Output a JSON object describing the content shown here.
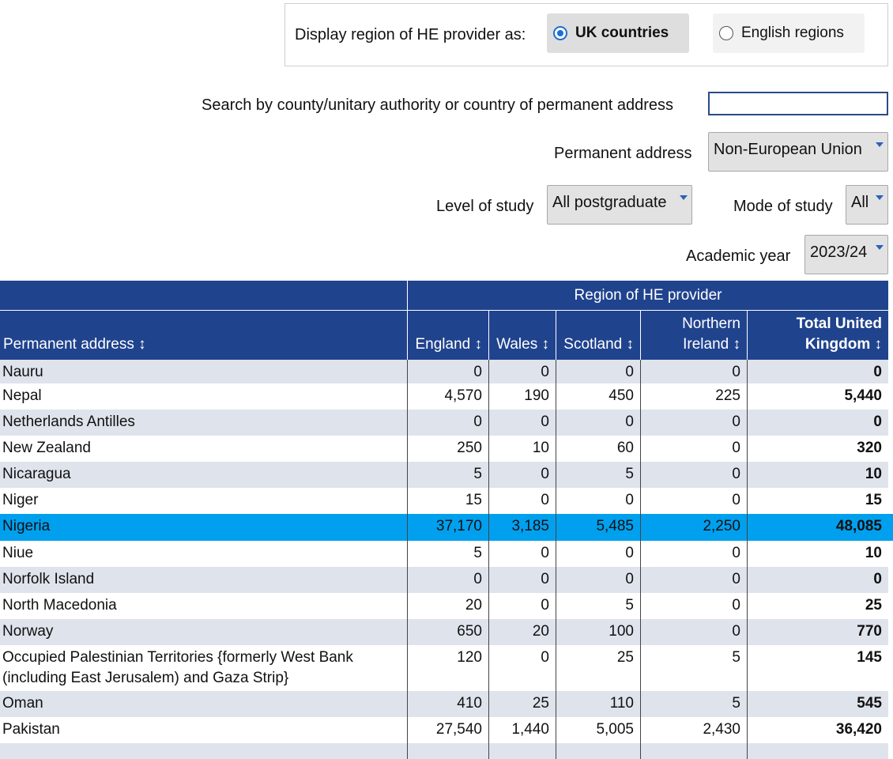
{
  "region_toggle": {
    "label": "Display region of HE provider as:",
    "options": [
      {
        "label": "UK countries",
        "selected": true
      },
      {
        "label": "English regions",
        "selected": false
      }
    ]
  },
  "filters": {
    "search_label": "Search by county/unitary authority or country of permanent address",
    "search_value": "",
    "permanent_address_label": "Permanent address",
    "permanent_address_value": "Non-European Union",
    "level_label": "Level of study",
    "level_value": "All postgraduate",
    "mode_label": "Mode of study",
    "mode_value": "All",
    "year_label": "Academic year",
    "year_value": "2023/24"
  },
  "table": {
    "group_header": "Region of HE provider",
    "columns": [
      {
        "label": "Permanent address ↕"
      },
      {
        "label": "England ↕"
      },
      {
        "label": "Wales ↕"
      },
      {
        "label": "Scotland ↕"
      },
      {
        "label": "Northern Ireland ↕"
      },
      {
        "label": "Total United Kingdom ↕"
      }
    ],
    "rows": [
      {
        "name": "Nauru",
        "england": "0",
        "wales": "0",
        "scotland": "0",
        "ni": "0",
        "total": "0"
      },
      {
        "name": "Nepal",
        "england": "4,570",
        "wales": "190",
        "scotland": "450",
        "ni": "225",
        "total": "5,440"
      },
      {
        "name": "Netherlands Antilles",
        "england": "0",
        "wales": "0",
        "scotland": "0",
        "ni": "0",
        "total": "0"
      },
      {
        "name": "New Zealand",
        "england": "250",
        "wales": "10",
        "scotland": "60",
        "ni": "0",
        "total": "320"
      },
      {
        "name": "Nicaragua",
        "england": "5",
        "wales": "0",
        "scotland": "5",
        "ni": "0",
        "total": "10"
      },
      {
        "name": "Niger",
        "england": "15",
        "wales": "0",
        "scotland": "0",
        "ni": "0",
        "total": "15"
      },
      {
        "name": "Nigeria",
        "england": "37,170",
        "wales": "3,185",
        "scotland": "5,485",
        "ni": "2,250",
        "total": "48,085",
        "highlighted": true
      },
      {
        "name": "Niue",
        "england": "5",
        "wales": "0",
        "scotland": "0",
        "ni": "0",
        "total": "10"
      },
      {
        "name": "Norfolk Island",
        "england": "0",
        "wales": "0",
        "scotland": "0",
        "ni": "0",
        "total": "0"
      },
      {
        "name": "North Macedonia",
        "england": "20",
        "wales": "0",
        "scotland": "5",
        "ni": "0",
        "total": "25"
      },
      {
        "name": "Norway",
        "england": "650",
        "wales": "20",
        "scotland": "100",
        "ni": "0",
        "total": "770"
      },
      {
        "name": "Occupied Palestinian Territories {formerly West Bank (including East Jerusalem) and Gaza Strip}",
        "england": "120",
        "wales": "0",
        "scotland": "25",
        "ni": "5",
        "total": "145"
      },
      {
        "name": "Oman",
        "england": "410",
        "wales": "25",
        "scotland": "110",
        "ni": "5",
        "total": "545"
      },
      {
        "name": "Pakistan",
        "england": "27,540",
        "wales": "1,440",
        "scotland": "5,005",
        "ni": "2,430",
        "total": "36,420"
      },
      {
        "name": "",
        "england": "",
        "wales": "",
        "scotland": "",
        "ni": "",
        "total": ""
      }
    ]
  }
}
